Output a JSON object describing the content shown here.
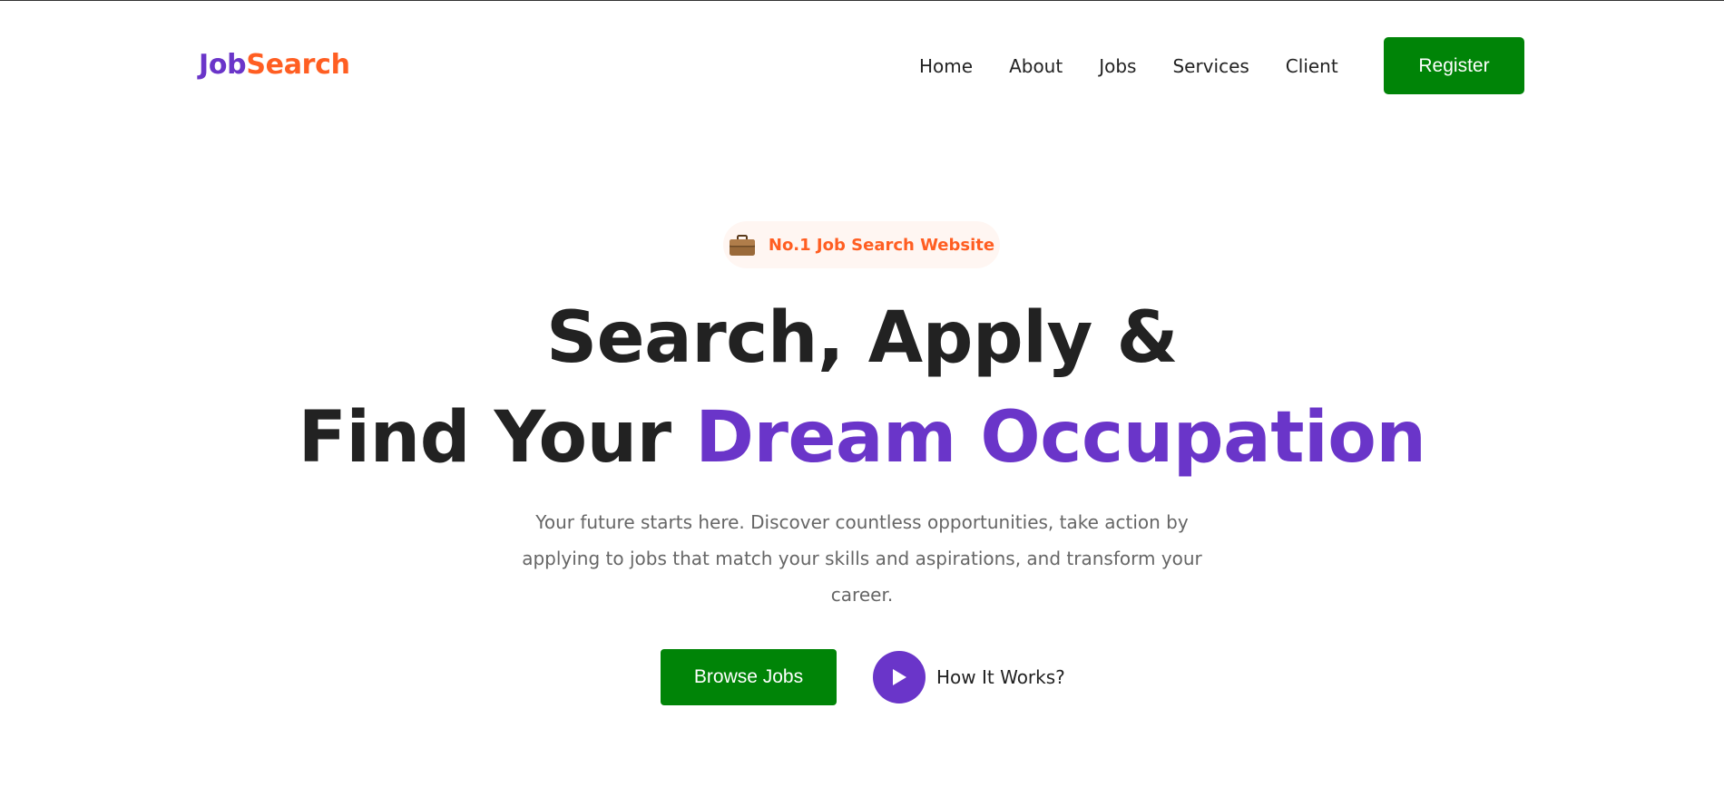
{
  "colors": {
    "brand_purple": "#6a35c9",
    "brand_orange": "#ff5e22",
    "button_green": "#008407",
    "text_dark": "#222222",
    "text_muted": "#666666",
    "badge_bg": "#fff6f2"
  },
  "header": {
    "logo": {
      "part1": "Job",
      "part2": "Search"
    },
    "nav": [
      {
        "label": "Home"
      },
      {
        "label": "About"
      },
      {
        "label": "Jobs"
      },
      {
        "label": "Services"
      },
      {
        "label": "Client"
      }
    ],
    "register_label": "Register"
  },
  "hero": {
    "badge": {
      "icon": "briefcase-icon",
      "text": "No.1 Job Search Website"
    },
    "title_line1": "Search, Apply &",
    "title_line2_prefix": "Find Your",
    "title_line2_accent": "Dream Occupation",
    "description": "Your future starts here. Discover countless opportunities, take action by applying to jobs that match your skills and aspirations, and transform your career.",
    "browse_label": "Browse Jobs",
    "how_it_works": {
      "icon": "play-icon",
      "label": "How It Works?"
    }
  }
}
